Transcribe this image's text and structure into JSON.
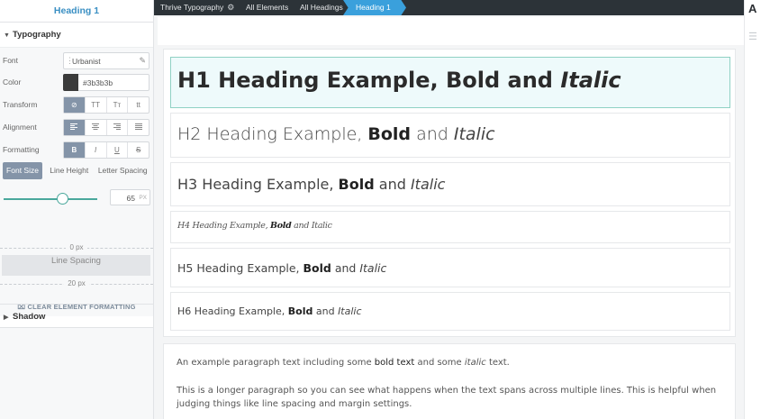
{
  "panel": {
    "title": "Heading 1",
    "typography_label": "Typography",
    "font_label": "Font",
    "font_value": "Urbanist",
    "color_label": "Color",
    "color_value": "#3b3b3b",
    "transform_label": "Transform",
    "transform_options": [
      "⊘",
      "TT",
      "Tт",
      "tt"
    ],
    "alignment_label": "Alignment",
    "formatting_label": "Formatting",
    "formatting_options": [
      "B",
      "I",
      "U",
      "S"
    ],
    "size_tabs": [
      "Font Size",
      "Line Height",
      "Letter Spacing"
    ],
    "font_size_value": "65",
    "font_size_unit": "PX",
    "spacing_top": "0 px",
    "line_spacing_label": "Line Spacing",
    "spacing_bottom": "20 px",
    "clear_label": "CLEAR ELEMENT FORMATTING",
    "shadow_label": "Shadow"
  },
  "breadcrumbs": [
    "Thrive Typography",
    "All Elements",
    "All Headings",
    "Heading 1"
  ],
  "headings": {
    "h1": {
      "pre": "H1 Heading Example, Bold and ",
      "italic": "Italic"
    },
    "h2": {
      "pre": "H2 Heading Example, ",
      "bold": "Bold",
      "mid": " and ",
      "italic": "Italic"
    },
    "h3": {
      "pre": "H3 Heading Example, ",
      "bold": "Bold",
      "mid": " and ",
      "italic": "Italic"
    },
    "h4": {
      "pre": "H4 Heading Example, ",
      "bold": "Bold",
      "mid": " and ",
      "italic": "Italic"
    },
    "h5": {
      "pre": "H5 Heading Example, ",
      "bold": "Bold",
      "mid": " and ",
      "italic": "Italic"
    },
    "h6": {
      "pre": "H6 Heading Example, ",
      "bold": "Bold",
      "mid": " and ",
      "italic": "Italic"
    }
  },
  "paragraphs": {
    "p1": {
      "pre": "An example paragraph text including some ",
      "bold": "bold text",
      "mid": " and some ",
      "italic": "italic",
      "post": " text."
    },
    "p2": "This is a longer paragraph so you can see what happens when the text spans across multiple lines. This is helpful when judging things like line spacing and margin settings."
  },
  "colors": {
    "accent": "#3aa0dc",
    "slider": "#4aa89c",
    "active_button": "#8494a8",
    "topbar": "#2c3338"
  }
}
